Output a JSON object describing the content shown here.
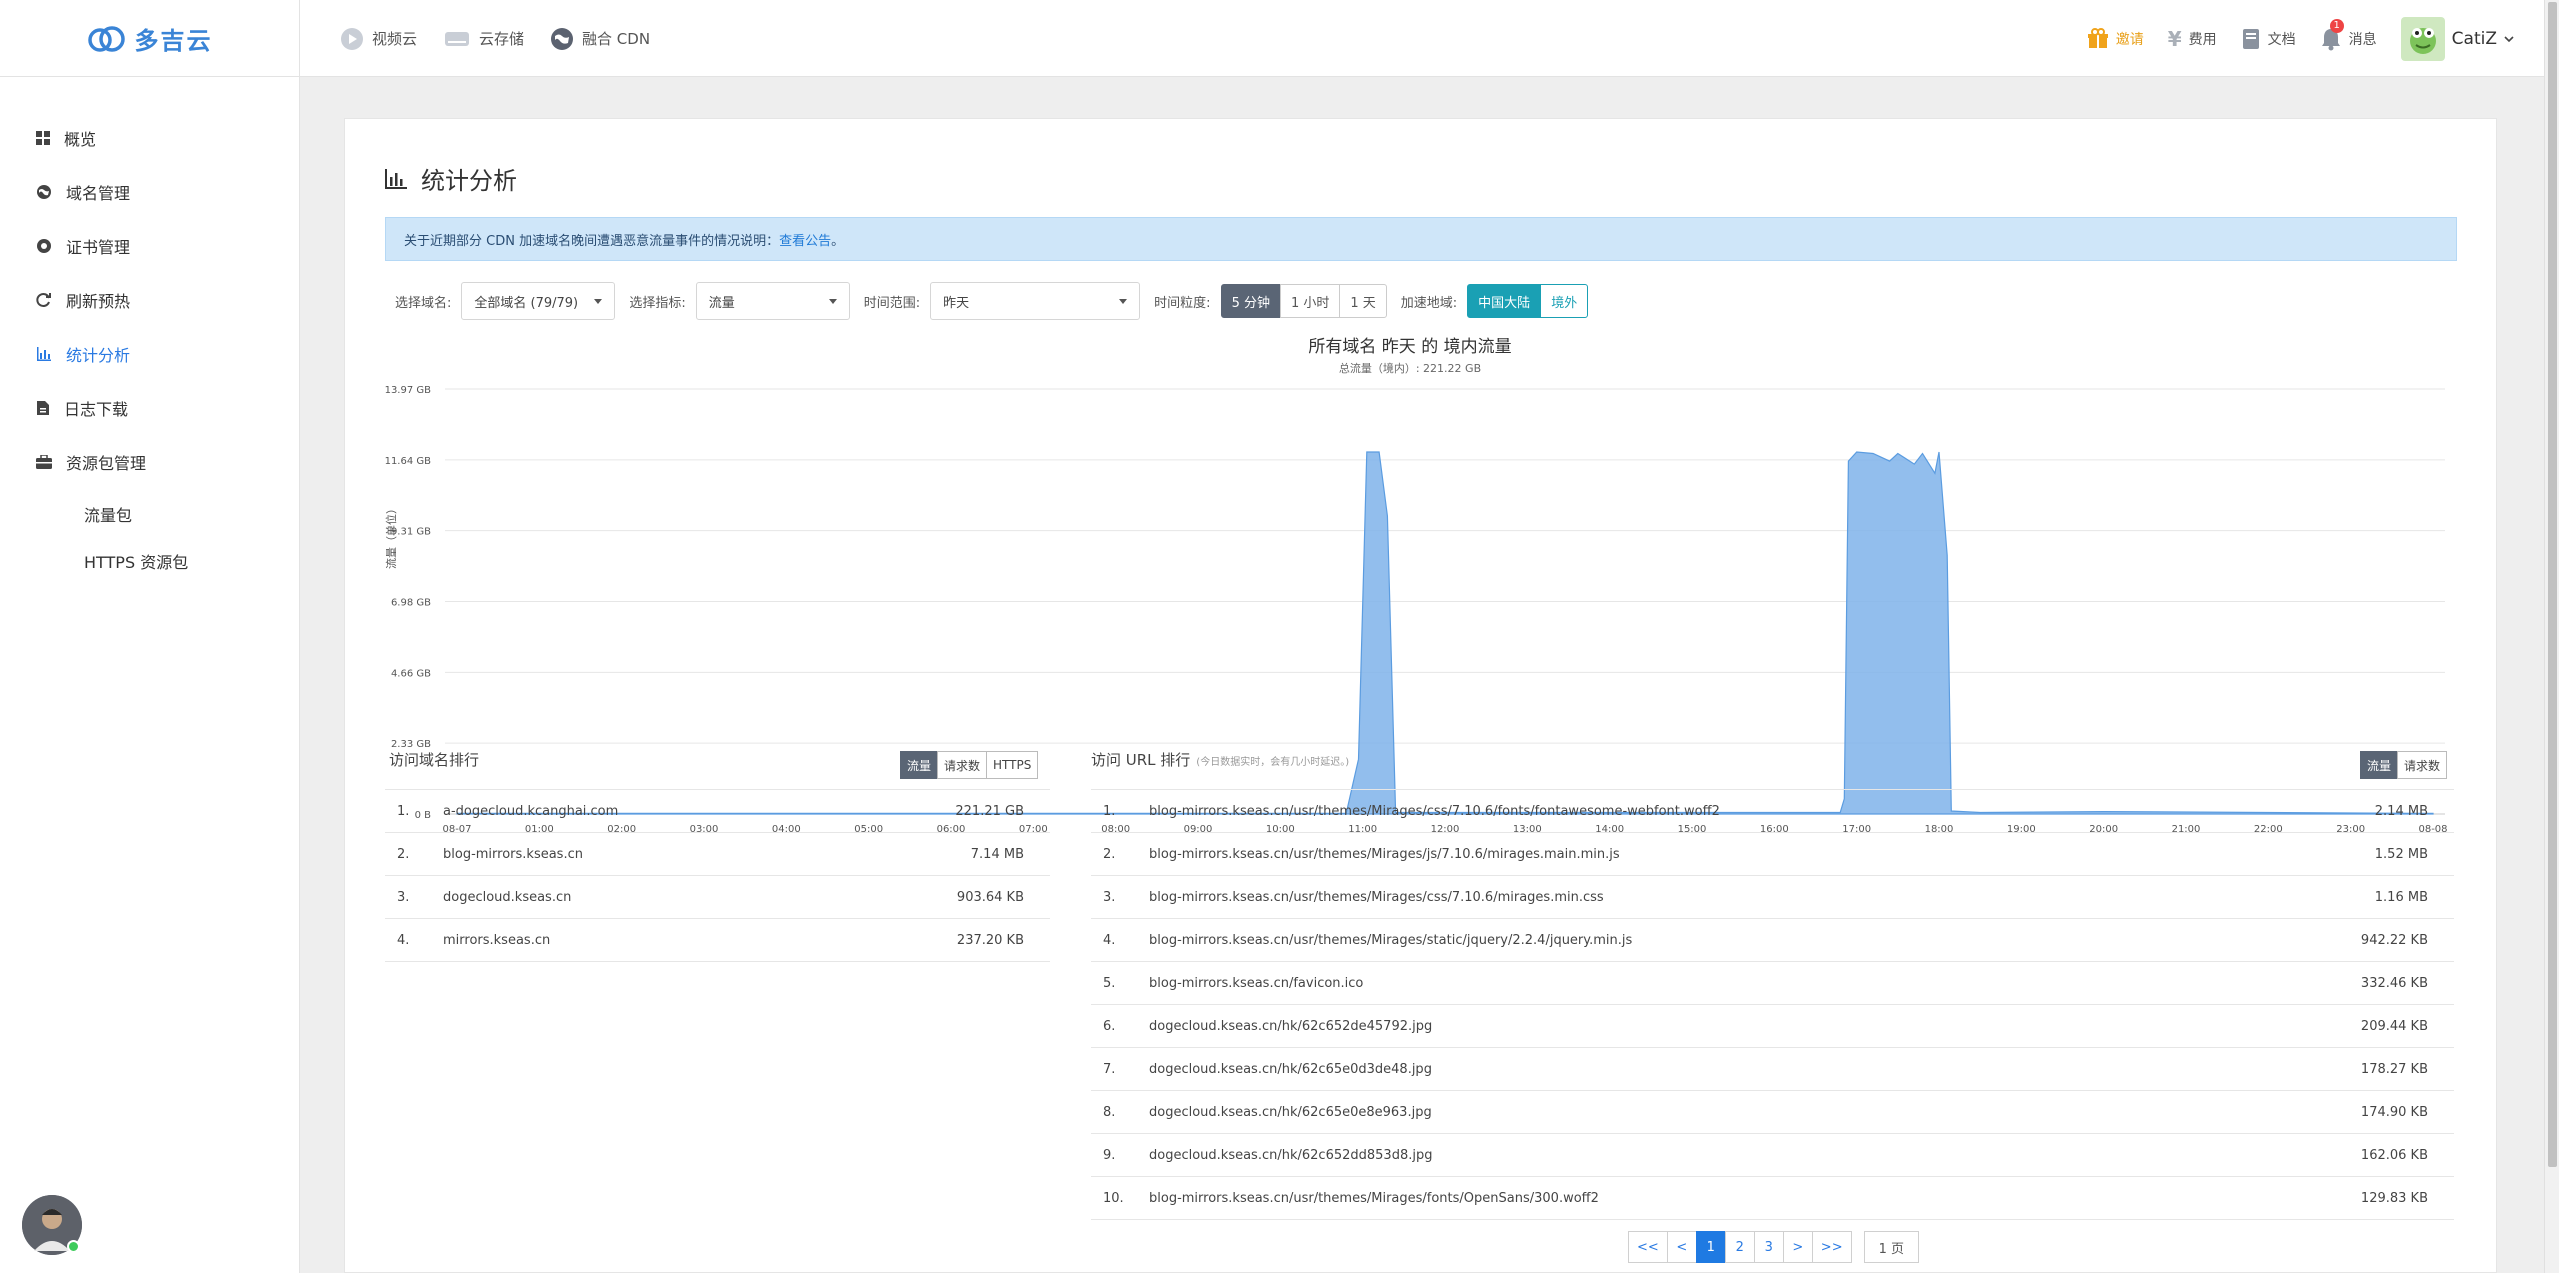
{
  "brand": {
    "name": "多吉云"
  },
  "top_nav": [
    {
      "label": "视频云",
      "icon": "play-circle-icon"
    },
    {
      "label": "云存储",
      "icon": "storage-drive-icon"
    },
    {
      "label": "融合 CDN",
      "icon": "globe-icon"
    }
  ],
  "top_right": {
    "invite": "邀请",
    "fee": "费用",
    "docs": "文档",
    "messages": "消息",
    "message_count": "1",
    "user": "CatiZ"
  },
  "sidebar": {
    "items": [
      {
        "label": "概览",
        "icon": "grid-icon"
      },
      {
        "label": "域名管理",
        "icon": "globe-icon"
      },
      {
        "label": "证书管理",
        "icon": "certificate-icon"
      },
      {
        "label": "刷新预热",
        "icon": "refresh-icon"
      },
      {
        "label": "统计分析",
        "icon": "bar-chart-icon"
      },
      {
        "label": "日志下载",
        "icon": "file-icon"
      },
      {
        "label": "资源包管理",
        "icon": "briefcase-icon"
      }
    ],
    "sub_items": [
      {
        "label": "流量包"
      },
      {
        "label": "HTTPS 资源包"
      }
    ]
  },
  "page": {
    "title": "统计分析",
    "notice_text": "关于近期部分 CDN 加速域名晚间遭遇恶意流量事件的情况说明：",
    "notice_link": "查看公告",
    "notice_end": "。"
  },
  "filters": {
    "domain_label": "选择域名:",
    "domain_value": "全部域名 (79/79)",
    "metric_label": "选择指标:",
    "metric_value": "流量",
    "range_label": "时间范围:",
    "range_value": "昨天",
    "granularity_label": "时间粒度:",
    "granularity": [
      "5 分钟",
      "1 小时",
      "1 天"
    ],
    "region_label": "加速地域:",
    "regions": [
      "中国大陆",
      "境外"
    ]
  },
  "chart_data": {
    "type": "area",
    "title": "所有域名 昨天 的 境内流量",
    "subtitle": "总流量（境内）: 221.22 GB",
    "ylabel": "流量（单位）",
    "yticks": [
      "0 B",
      "2.33 GB",
      "4.66 GB",
      "6.98 GB",
      "9.31 GB",
      "11.64 GB",
      "13.97 GB"
    ],
    "ylim_gb": [
      0,
      13.97
    ],
    "xticks": [
      "08-07",
      "01:00",
      "02:00",
      "03:00",
      "04:00",
      "05:00",
      "06:00",
      "07:00",
      "08:00",
      "09:00",
      "10:00",
      "11:00",
      "12:00",
      "13:00",
      "14:00",
      "15:00",
      "16:00",
      "17:00",
      "18:00",
      "19:00",
      "20:00",
      "21:00",
      "22:00",
      "23:00",
      "08-08"
    ],
    "series": [
      {
        "color": "#7fb3ea",
        "points_hours_gb": [
          [
            0,
            0.02
          ],
          [
            10.8,
            0.02
          ],
          [
            10.95,
            1.8
          ],
          [
            11.05,
            11.9
          ],
          [
            11.2,
            11.9
          ],
          [
            11.3,
            9.8
          ],
          [
            11.4,
            0.05
          ],
          [
            16.8,
            0.05
          ],
          [
            16.85,
            0.5
          ],
          [
            16.9,
            11.6
          ],
          [
            17.0,
            11.9
          ],
          [
            17.2,
            11.85
          ],
          [
            17.4,
            11.6
          ],
          [
            17.5,
            11.85
          ],
          [
            17.7,
            11.5
          ],
          [
            17.8,
            11.85
          ],
          [
            17.95,
            11.2
          ],
          [
            18.0,
            11.9
          ],
          [
            18.1,
            8.5
          ],
          [
            18.15,
            0.1
          ],
          [
            18.5,
            0.05
          ],
          [
            20.0,
            0.08
          ],
          [
            24.0,
            0.02
          ]
        ]
      }
    ],
    "grid": true,
    "legend": false
  },
  "domain_rank": {
    "title": "访问域名排行",
    "tabs": [
      "流量",
      "请求数",
      "HTTPS"
    ],
    "rows": [
      {
        "idx": "1.",
        "name": "a-dogecloud.kcanghai.com",
        "value": "221.21 GB"
      },
      {
        "idx": "2.",
        "name": "blog-mirrors.kseas.cn",
        "value": "7.14 MB"
      },
      {
        "idx": "3.",
        "name": "dogecloud.kseas.cn",
        "value": "903.64 KB"
      },
      {
        "idx": "4.",
        "name": "mirrors.kseas.cn",
        "value": "237.20 KB"
      }
    ]
  },
  "url_rank": {
    "title": "访问 URL 排行",
    "note": "(今日数据实时，会有几小时延迟。)",
    "tabs": [
      "流量",
      "请求数"
    ],
    "rows": [
      {
        "idx": "1.",
        "name": "blog-mirrors.kseas.cn/usr/themes/Mirages/css/7.10.6/fonts/fontawesome-webfont.woff2",
        "value": "2.14 MB"
      },
      {
        "idx": "2.",
        "name": "blog-mirrors.kseas.cn/usr/themes/Mirages/js/7.10.6/mirages.main.min.js",
        "value": "1.52 MB"
      },
      {
        "idx": "3.",
        "name": "blog-mirrors.kseas.cn/usr/themes/Mirages/css/7.10.6/mirages.min.css",
        "value": "1.16 MB"
      },
      {
        "idx": "4.",
        "name": "blog-mirrors.kseas.cn/usr/themes/Mirages/static/jquery/2.2.4/jquery.min.js",
        "value": "942.22 KB"
      },
      {
        "idx": "5.",
        "name": "blog-mirrors.kseas.cn/favicon.ico",
        "value": "332.46 KB"
      },
      {
        "idx": "6.",
        "name": "dogecloud.kseas.cn/hk/62c652de45792.jpg",
        "value": "209.44 KB"
      },
      {
        "idx": "7.",
        "name": "dogecloud.kseas.cn/hk/62c65e0d3de48.jpg",
        "value": "178.27 KB"
      },
      {
        "idx": "8.",
        "name": "dogecloud.kseas.cn/hk/62c65e0e8e963.jpg",
        "value": "174.90 KB"
      },
      {
        "idx": "9.",
        "name": "dogecloud.kseas.cn/hk/62c652dd853d8.jpg",
        "value": "162.06 KB"
      },
      {
        "idx": "10.",
        "name": "blog-mirrors.kseas.cn/usr/themes/Mirages/fonts/OpenSans/300.woff2",
        "value": "129.83 KB"
      }
    ]
  },
  "pager": {
    "first": "<<",
    "prev": "<",
    "pages": [
      "1",
      "2",
      "3"
    ],
    "next": ">",
    "last": ">>",
    "current": "1",
    "total": "1 页"
  }
}
